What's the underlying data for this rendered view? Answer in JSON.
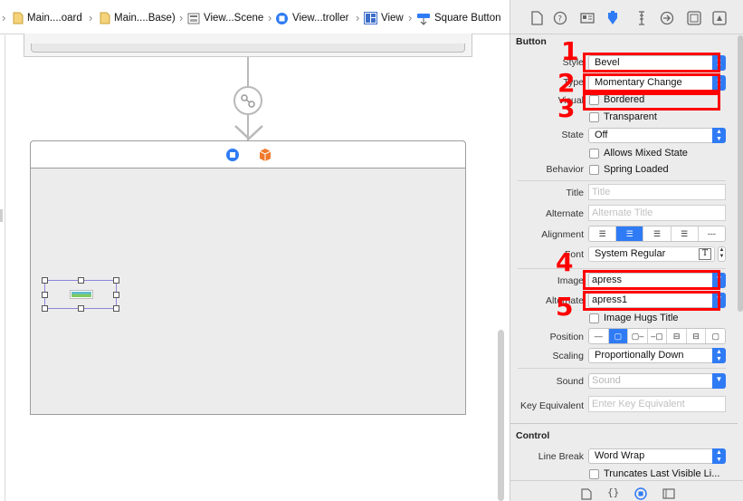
{
  "breadcrumb": [
    {
      "label": "",
      "icon": "folder-icon"
    },
    {
      "label": "Main....oard",
      "icon": "storyboard-file-icon"
    },
    {
      "label": "Main....Base)",
      "icon": "storyboard-file-icon"
    },
    {
      "label": "View...Scene",
      "icon": "scene-icon"
    },
    {
      "label": "View...troller",
      "icon": "view-controller-icon"
    },
    {
      "label": "View",
      "icon": "view-icon"
    },
    {
      "label": "Square Button",
      "icon": "button-icon"
    }
  ],
  "inspector_tabs": [
    "file-inspector-icon",
    "quick-help-icon",
    "identity-icon",
    "attributes-inspector-icon",
    "size-inspector-icon",
    "connections-inspector-icon",
    "bindings-icon",
    "view-effects-icon"
  ],
  "button_section": {
    "title": "Button",
    "style": {
      "label": "Style",
      "value": "Bevel"
    },
    "type": {
      "label": "Type",
      "value": "Momentary Change"
    },
    "visual": {
      "label": "Visual",
      "bordered": "Bordered",
      "transparent": "Transparent"
    },
    "state": {
      "label": "State",
      "value": "Off",
      "allows_mixed": "Allows Mixed State"
    },
    "behavior": {
      "label": "Behavior",
      "spring_loaded": "Spring Loaded"
    },
    "title_field": {
      "label": "Title",
      "placeholder": "Title"
    },
    "alternate_field": {
      "label": "Alternate",
      "placeholder": "Alternate Title"
    },
    "alignment": {
      "label": "Alignment",
      "selected": 1,
      "options": [
        "left",
        "center",
        "right",
        "justify",
        "natural"
      ]
    },
    "font": {
      "label": "Font",
      "value": "System Regular"
    },
    "image": {
      "label": "Image",
      "value": "apress"
    },
    "alternate_image": {
      "label": "Alternate",
      "value": "apress1"
    },
    "image_hugs_title": "Image Hugs Title",
    "position": {
      "label": "Position",
      "selected": 1
    },
    "scaling": {
      "label": "Scaling",
      "value": "Proportionally Down"
    },
    "sound": {
      "label": "Sound",
      "value": "Sound"
    },
    "key_equivalent": {
      "label": "Key Equivalent",
      "placeholder": "Enter Key Equivalent"
    }
  },
  "control_section": {
    "title": "Control",
    "line_break": {
      "label": "Line Break",
      "value": "Word Wrap"
    },
    "truncates": "Truncates Last Visible Li..."
  },
  "bottom_tabs": [
    "file-template-icon",
    "code-snippet-icon",
    "object-library-icon",
    "media-library-icon"
  ],
  "annotations": [
    "1",
    "2",
    "3",
    "4",
    "5"
  ],
  "colors": {
    "accent": "#2f7bf5",
    "annotation": "#ff0000",
    "selection": "#8d86dc"
  }
}
